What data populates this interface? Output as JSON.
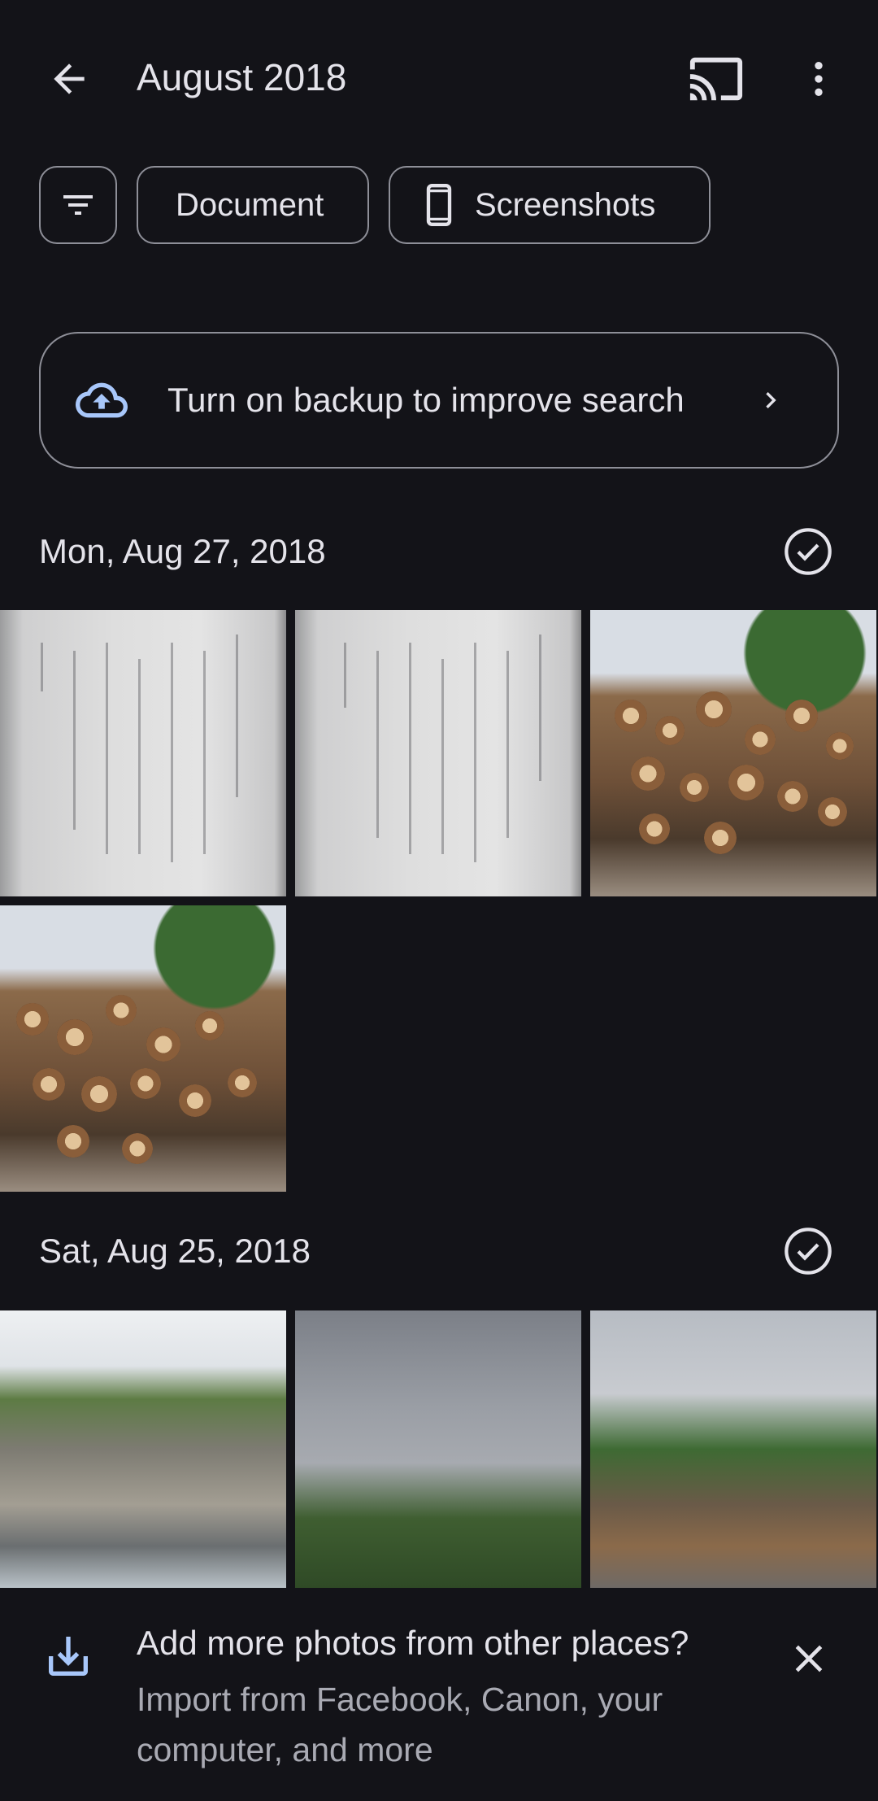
{
  "header": {
    "title": "August 2018",
    "back_icon": "arrow-back-icon",
    "cast_icon": "cast-icon",
    "more_icon": "more-vert-icon"
  },
  "chips": {
    "filter_icon": "filter-icon",
    "document_label": "Document",
    "screenshots_label": "Screenshots",
    "screenshots_icon": "phone-icon"
  },
  "backup": {
    "text": "Turn on backup to improve search",
    "icon": "cloud-upload-icon",
    "accent": "#a8c7fa"
  },
  "sections": [
    {
      "date": "Mon, Aug 27, 2018",
      "photos": 4
    },
    {
      "date": "Sat, Aug 25, 2018",
      "photos": 3
    }
  ],
  "import_prompt": {
    "headline": "Add more photos from other places?",
    "subtext": "Import from Facebook, Canon, your computer, and more",
    "icon": "download-icon",
    "close_icon": "close-icon"
  }
}
